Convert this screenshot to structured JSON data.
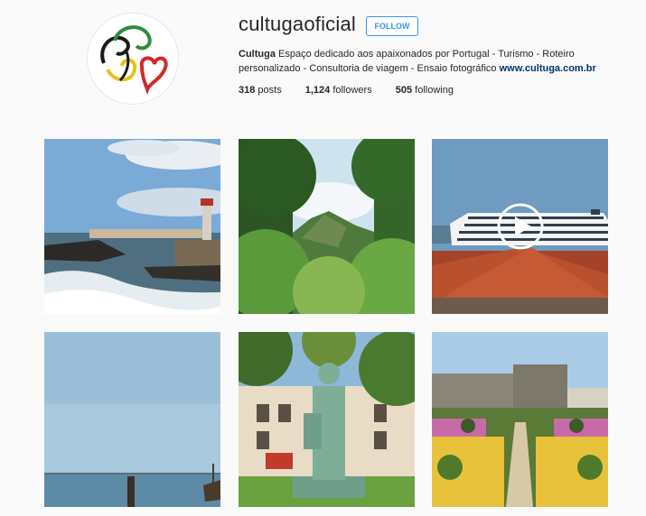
{
  "profile": {
    "username": "cultuga",
    "username_display": "cultugaoficial",
    "follow_label": "FOLLOW",
    "bio_name": "Cultuga",
    "bio_text": "Espaço dedicado aos apaixonados por Portugal - Turismo - Roteiro personalizado - Consultoria de viagem - Ensaio fotográfico",
    "bio_link": "www.cultuga.com.br",
    "accent_color": "#3897f0",
    "link_color": "#003569"
  },
  "stats": {
    "posts_value": "318",
    "posts_label": "posts",
    "followers_value": "1,124",
    "followers_label": "followers",
    "following_value": "505",
    "following_label": "following"
  },
  "posts": [
    {
      "subject": "coastal-lighthouse",
      "is_video": false
    },
    {
      "subject": "forest-mountain",
      "is_video": false
    },
    {
      "subject": "cruise-ship-rooftop",
      "is_video": true,
      "icon": "play-icon"
    },
    {
      "subject": "sea-horizon-pier",
      "is_video": false
    },
    {
      "subject": "statue-square",
      "is_video": false
    },
    {
      "subject": "castle-garden",
      "is_video": false
    }
  ]
}
